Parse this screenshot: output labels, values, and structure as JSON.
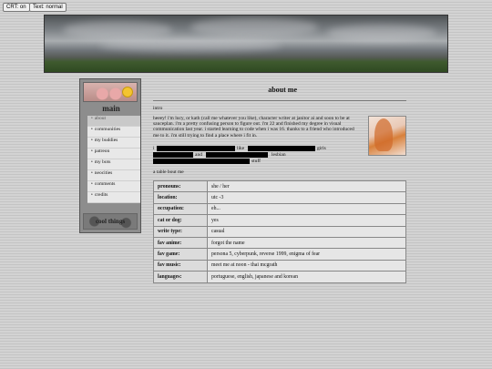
{
  "controls": {
    "crt": "CRT: on",
    "text_mode": "Text: normal"
  },
  "sidebar": {
    "title": "main",
    "items": [
      {
        "label": "about",
        "active": true
      },
      {
        "label": "communities"
      },
      {
        "label": "my buddies"
      },
      {
        "label": "patreon"
      },
      {
        "label": "my bots"
      },
      {
        "label": "neocities"
      },
      {
        "label": "comments"
      },
      {
        "label": "credits"
      }
    ],
    "bottom_label": "cool things"
  },
  "main": {
    "title": "about me",
    "intro_label": "intro",
    "intro_text": "heeey! i'm lucy, or kath (call me whatever you like), character writer at janitor ai and soon to be at sauceplan. i'm a pretty confusing person to figure out. i'm 22 and finished my degree in visual communication last year. i started learning to code when i was 16. thanks to a friend who introduced me to it. i'm still trying to find a place where i fit in.",
    "redacted_line1": {
      "start": "i",
      "mid": "like",
      "end": "girls"
    },
    "redacted_line2": {
      "a": "and",
      "b": "lesbian",
      "c": "stuff"
    },
    "table_label": "a table bout me",
    "table": [
      {
        "key": "pronouns:",
        "value": "she / her"
      },
      {
        "key": "location:",
        "value": "utc -3"
      },
      {
        "key": "occupation:",
        "value": "eh..."
      },
      {
        "key": "cat or dog:",
        "value": "yes"
      },
      {
        "key": "write type:",
        "value": "casual"
      },
      {
        "key": "fav anime:",
        "value": "forgot the name"
      },
      {
        "key": "fav game:",
        "value": "persona 5, cyberpunk, reverse 1999, enigma of fear"
      },
      {
        "key": "fav music:",
        "value": "meet me at noon - thai mcgrath"
      },
      {
        "key": "languages:",
        "value": "portuguese, english, japanese and korean"
      }
    ]
  }
}
